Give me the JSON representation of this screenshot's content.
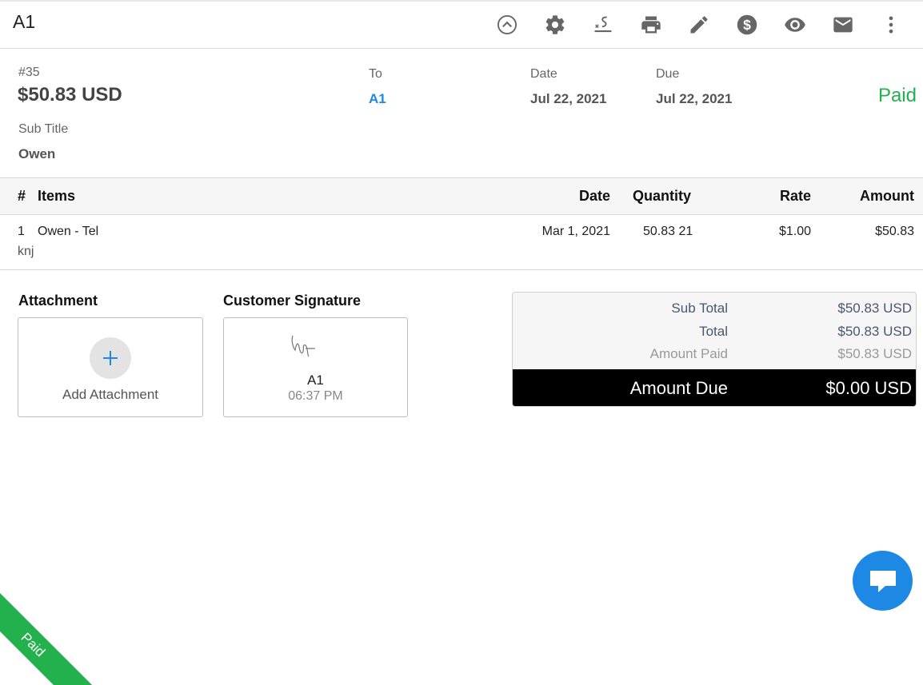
{
  "header": {
    "title": "A1",
    "toolbar_icons": [
      "chevron-up-circle-icon",
      "gear-icon",
      "signature-icon",
      "print-icon",
      "pencil-icon",
      "dollar-icon",
      "eye-icon",
      "mail-icon",
      "more-vertical-icon"
    ]
  },
  "invoice": {
    "number": "#35",
    "amount": "$50.83 USD",
    "subtitle_label": "Sub Title",
    "subtitle_value": "Owen",
    "to_label": "To",
    "to_value": "A1",
    "date_label": "Date",
    "date_value": "Jul 22, 2021",
    "due_label": "Due",
    "due_value": "Jul 22, 2021",
    "status": "Paid"
  },
  "items_table": {
    "headers": {
      "num": "#",
      "items": "Items",
      "date": "Date",
      "quantity": "Quantity",
      "rate": "Rate",
      "amount": "Amount"
    },
    "rows": [
      {
        "num": "1",
        "name": "Owen - Tel",
        "description": "knj",
        "date": "Mar 1, 2021",
        "quantity": "50.83 21",
        "rate": "$1.00",
        "amount": "$50.83"
      }
    ]
  },
  "attachment": {
    "label": "Attachment",
    "add_text": "Add Attachment"
  },
  "signature": {
    "label": "Customer Signature",
    "name": "A1",
    "time": "06:37 PM"
  },
  "totals": {
    "sub_total_label": "Sub Total",
    "sub_total_value": "$50.83 USD",
    "total_label": "Total",
    "total_value": "$50.83 USD",
    "amount_paid_label": "Amount Paid",
    "amount_paid_value": "$50.83 USD",
    "amount_due_label": "Amount Due",
    "amount_due_value": "$0.00 USD"
  },
  "ribbon": {
    "label": "Paid"
  },
  "colors": {
    "accent": "#1e88e5",
    "paid": "#22b14c",
    "due_bar": "#000000"
  }
}
